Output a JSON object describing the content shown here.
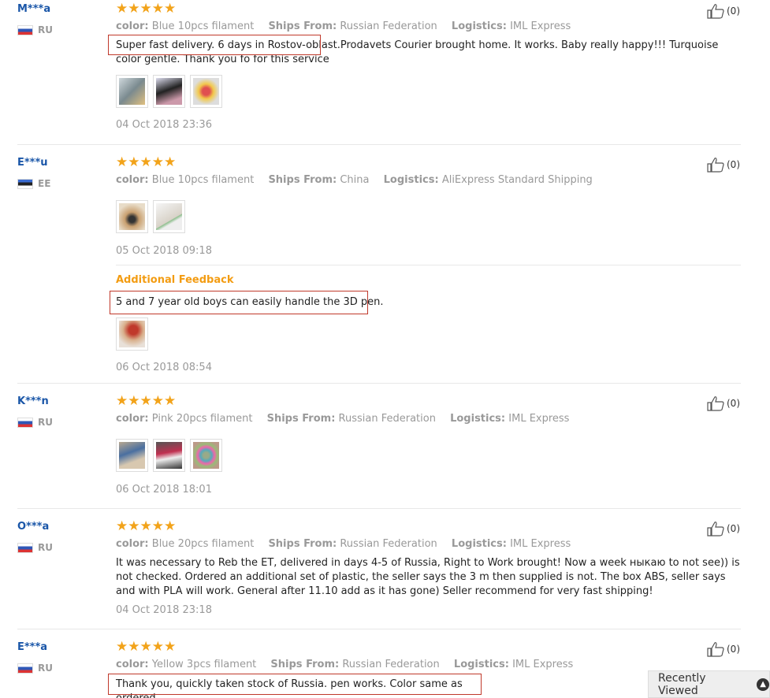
{
  "reviews": [
    {
      "user": "M***a",
      "country": "RU",
      "color_label": "color:",
      "color": "Blue 10pcs filament",
      "ships_label": "Ships From:",
      "ships": "Russian Federation",
      "logistics_label": "Logistics:",
      "logistics": "IML Express",
      "text": "Super fast delivery. 6 days in Rostov-oblast.Prodavets Courier brought home. It works. Baby really happy!!! Turquoise color gentle. Thank you fo for this service",
      "date": "04 Oct 2018 23:36",
      "likes": "(0)"
    },
    {
      "user": "E***u",
      "country": "EE",
      "color_label": "color:",
      "color": "Blue 10pcs filament",
      "ships_label": "Ships From:",
      "ships": "China",
      "logistics_label": "Logistics:",
      "logistics": "AliExpress Standard Shipping",
      "date": "05 Oct 2018 09:18",
      "additional_label": "Additional Feedback",
      "additional_text": "5 and 7 year old boys can easily handle the 3D pen.",
      "additional_date": "06 Oct 2018 08:54",
      "likes": "(0)"
    },
    {
      "user": "K***n",
      "country": "RU",
      "color_label": "color:",
      "color": "Pink 20pcs filament",
      "ships_label": "Ships From:",
      "ships": "Russian Federation",
      "logistics_label": "Logistics:",
      "logistics": "IML Express",
      "date": "06 Oct 2018 18:01",
      "likes": "(0)"
    },
    {
      "user": "O***a",
      "country": "RU",
      "color_label": "color:",
      "color": "Blue 20pcs filament",
      "ships_label": "Ships From:",
      "ships": "Russian Federation",
      "logistics_label": "Logistics:",
      "logistics": "IML Express",
      "text": "It was necessary to Reb the ET, delivered in days 4-5 of Russia, Right to Work brought! Now a week ныкаю to not see)) is not checked. Ordered an additional set of plastic, the seller says the 3 m then supplied is not. The box ABS, seller says and with PLA will work. General after 11.10 add as it has gone) Seller recommend for very fast shipping!",
      "date": "04 Oct 2018 23:18",
      "likes": "(0)"
    },
    {
      "user": "E***a",
      "country": "RU",
      "color_label": "color:",
      "color": "Yellow 3pcs filament",
      "ships_label": "Ships From:",
      "ships": "Russian Federation",
      "logistics_label": "Logistics:",
      "logistics": "IML Express",
      "text": "Thank you, quickly taken stock of Russia. pen works. Color same as ordered.",
      "likes": "(0)"
    }
  ],
  "stars": "★★★★★",
  "recently_viewed": "Recently Viewed",
  "recently_viewed_icon": "chevron-up-icon",
  "colors": {
    "user": "#1a56a8",
    "star": "#f2a31a",
    "additional": "#f39c12",
    "highlight": "#c0392b"
  }
}
